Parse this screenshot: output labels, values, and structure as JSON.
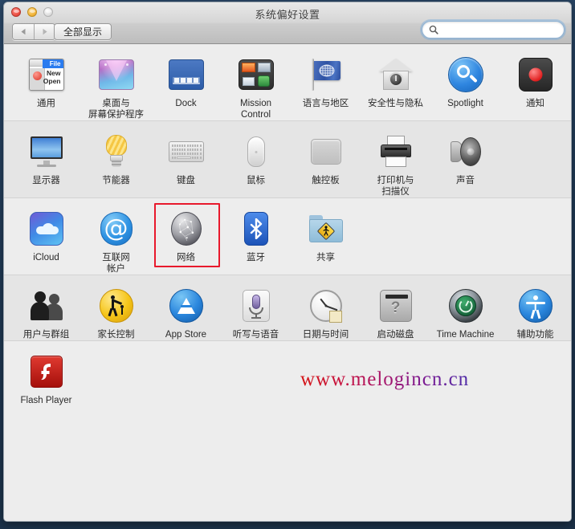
{
  "window": {
    "title": "系统偏好设置",
    "traffic_lights": [
      {
        "name": "close",
        "color": "#e8483c"
      },
      {
        "name": "minimize",
        "color": "#f0b132"
      },
      {
        "name": "zoom",
        "color": "#dcdcdc"
      }
    ]
  },
  "toolbar": {
    "back_label": "◀",
    "forward_label": "▶",
    "show_all_label": "全部显示",
    "search": {
      "value": "",
      "placeholder": ""
    }
  },
  "watermark": {
    "text": "www.melogincn.cn",
    "color_start": "#d61414",
    "color_end": "#4f2da8"
  },
  "selection": {
    "selected_pane": "网络",
    "highlight_color": "#e8192c"
  },
  "rows": [
    {
      "id": "personal",
      "shade": "norm",
      "panes": [
        {
          "label": "通用",
          "icon": "general-icon"
        },
        {
          "label": "桌面与\n屏幕保护程序",
          "icon": "desktop-screensaver-icon"
        },
        {
          "label": "Dock",
          "icon": "dock-icon"
        },
        {
          "label": "Mission\nControl",
          "icon": "mission-control-icon"
        },
        {
          "label": "语言与地区",
          "icon": "language-region-icon"
        },
        {
          "label": "安全性与隐私",
          "icon": "security-privacy-icon"
        },
        {
          "label": "Spotlight",
          "icon": "spotlight-icon"
        },
        {
          "label": "通知",
          "icon": "notifications-icon"
        }
      ]
    },
    {
      "id": "hardware",
      "shade": "alt",
      "panes": [
        {
          "label": "显示器",
          "icon": "displays-icon"
        },
        {
          "label": "节能器",
          "icon": "energy-saver-icon"
        },
        {
          "label": "键盘",
          "icon": "keyboard-icon"
        },
        {
          "label": "鼠标",
          "icon": "mouse-icon"
        },
        {
          "label": "触控板",
          "icon": "trackpad-icon"
        },
        {
          "label": "打印机与\n扫描仪",
          "icon": "printers-scanners-icon"
        },
        {
          "label": "声音",
          "icon": "sound-icon"
        }
      ]
    },
    {
      "id": "internet",
      "shade": "norm",
      "panes": [
        {
          "label": "iCloud",
          "icon": "icloud-icon"
        },
        {
          "label": "互联网\n帐户",
          "icon": "internet-accounts-icon"
        },
        {
          "label": "网络",
          "icon": "network-icon"
        },
        {
          "label": "蓝牙",
          "icon": "bluetooth-icon"
        },
        {
          "label": "共享",
          "icon": "sharing-icon"
        }
      ]
    },
    {
      "id": "system",
      "shade": "alt",
      "panes": [
        {
          "label": "用户与群组",
          "icon": "users-groups-icon"
        },
        {
          "label": "家长控制",
          "icon": "parental-controls-icon"
        },
        {
          "label": "App Store",
          "icon": "app-store-icon"
        },
        {
          "label": "听写与语音",
          "icon": "dictation-speech-icon"
        },
        {
          "label": "日期与时间",
          "icon": "date-time-icon"
        },
        {
          "label": "启动磁盘",
          "icon": "startup-disk-icon"
        },
        {
          "label": "Time Machine",
          "icon": "time-machine-icon"
        },
        {
          "label": "辅助功能",
          "icon": "accessibility-icon"
        }
      ]
    },
    {
      "id": "other",
      "shade": "norm",
      "panes": [
        {
          "label": "Flash Player",
          "icon": "flash-player-icon"
        }
      ]
    }
  ]
}
